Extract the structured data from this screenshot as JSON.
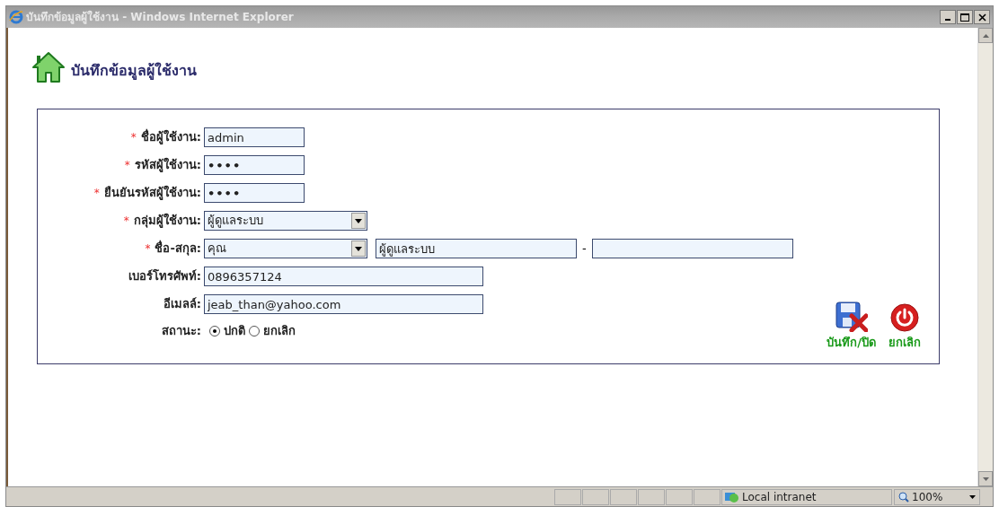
{
  "window": {
    "title": "บันทึกข้อมูลผู้ใช้งาน - Windows Internet Explorer"
  },
  "page": {
    "heading": "บันทึกข้อมูลผู้ใช้งาน"
  },
  "form": {
    "fields": [
      {
        "kind": "text",
        "label": "ชื่อผู้ใช้งาน:",
        "required_mark": "*",
        "value": "admin"
      },
      {
        "kind": "password",
        "label": "รหัสผู้ใช้งาน:",
        "required_mark": "*",
        "value": "••••"
      },
      {
        "kind": "password",
        "label": "ยืนยันรหัสผู้ใช้งาน:",
        "required_mark": "*",
        "value": "••••"
      },
      {
        "kind": "select",
        "label": "กลุ่มผู้ใช้งาน:",
        "required_mark": "*",
        "value": "ผู้ดูแลระบบ"
      },
      {
        "kind": "name",
        "label": "ชื่อ-สกุล:",
        "required_mark": "*",
        "prefix": "คุณ",
        "first_name": "ผู้ดูแลระบบ",
        "separator": "-"
      },
      {
        "kind": "wide",
        "label": "เบอร์โทรศัพท์:",
        "value": "0896357124"
      },
      {
        "kind": "wide",
        "label": "อีเมลล์:",
        "value": "jeab_than@yahoo.com"
      },
      {
        "kind": "radio",
        "label": "สถานะ:",
        "options": [
          {
            "label": "ปกติ",
            "selected": true
          },
          {
            "label": "ยกเลิก",
            "selected": false
          }
        ]
      }
    ]
  },
  "actions": [
    {
      "kind": "save-close",
      "label": "บันทึก/ปิด"
    },
    {
      "kind": "cancel",
      "label": "ยกเลิก"
    }
  ],
  "status_bar": {
    "zone": "Local intranet",
    "zoom": "100%"
  }
}
